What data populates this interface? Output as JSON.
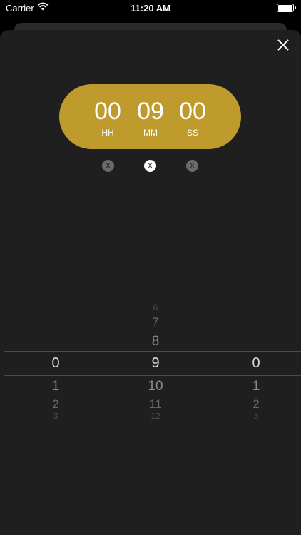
{
  "status_bar": {
    "carrier": "Carrier",
    "time": "11:20 AM"
  },
  "timer": {
    "hours": "00",
    "minutes": "09",
    "seconds": "00",
    "hours_label": "HH",
    "minutes_label": "MM",
    "seconds_label": "SS",
    "accent_color": "#bf9a2c"
  },
  "clear_buttons": {
    "hours": "x",
    "minutes": "x",
    "seconds": "x"
  },
  "picker": {
    "hours": {
      "selected": "0",
      "below": [
        "1",
        "2",
        "3"
      ]
    },
    "minutes": {
      "above": [
        "6",
        "7",
        "8"
      ],
      "selected": "9",
      "below": [
        "10",
        "11",
        "12"
      ]
    },
    "seconds": {
      "selected": "0",
      "below": [
        "1",
        "2",
        "3"
      ]
    }
  }
}
